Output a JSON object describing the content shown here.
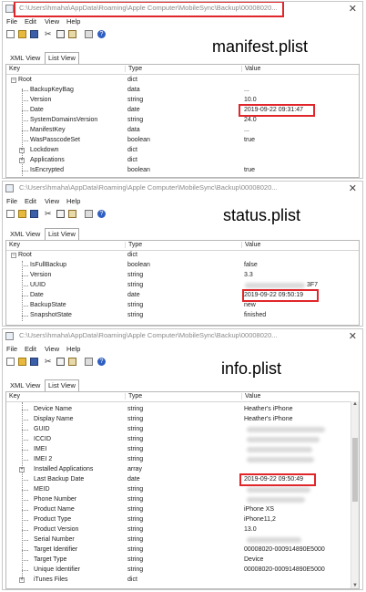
{
  "menu": [
    "File",
    "Edit",
    "View",
    "Help"
  ],
  "tabs": [
    "XML View",
    "List View"
  ],
  "columns": [
    "Key",
    "Type",
    "Value"
  ],
  "close_glyph": "✕",
  "panels": [
    {
      "title": "C:\\Users\\hmaha\\AppData\\Roaming\\Apple Computer\\MobileSync\\Backup\\00008020...",
      "caption": "manifest.plist",
      "rows": [
        {
          "key": "Root",
          "type": "dict",
          "value": ""
        },
        {
          "key": "BackupKeyBag",
          "type": "data",
          "value": "..."
        },
        {
          "key": "Version",
          "type": "string",
          "value": "10.0"
        },
        {
          "key": "Date",
          "type": "date",
          "value": "2019-09-22 09:31:47"
        },
        {
          "key": "SystemDomainsVersion",
          "type": "string",
          "value": "24.0"
        },
        {
          "key": "ManifestKey",
          "type": "data",
          "value": "..."
        },
        {
          "key": "WasPasscodeSet",
          "type": "boolean",
          "value": "true"
        },
        {
          "key": "Lockdown",
          "type": "dict",
          "value": ""
        },
        {
          "key": "Applications",
          "type": "dict",
          "value": ""
        },
        {
          "key": "IsEncrypted",
          "type": "boolean",
          "value": "true"
        }
      ]
    },
    {
      "title": "C:\\Users\\hmaha\\AppData\\Roaming\\Apple Computer\\MobileSync\\Backup\\00008020...",
      "caption": "status.plist",
      "rows": [
        {
          "key": "Root",
          "type": "dict",
          "value": ""
        },
        {
          "key": "IsFullBackup",
          "type": "boolean",
          "value": "false"
        },
        {
          "key": "Version",
          "type": "string",
          "value": "3.3"
        },
        {
          "key": "UUID",
          "type": "string",
          "value": "3F7"
        },
        {
          "key": "Date",
          "type": "date",
          "value": "2019-09-22 09:50:19"
        },
        {
          "key": "BackupState",
          "type": "string",
          "value": "new"
        },
        {
          "key": "SnapshotState",
          "type": "string",
          "value": "finished"
        }
      ]
    },
    {
      "title": "C:\\Users\\hmaha\\AppData\\Roaming\\Apple Computer\\MobileSync\\Backup\\00008020...",
      "caption": "info.plist",
      "rows": [
        {
          "key": "Device Name",
          "type": "string",
          "value": "Heather's iPhone"
        },
        {
          "key": "Display Name",
          "type": "string",
          "value": "Heather's iPhone"
        },
        {
          "key": "GUID",
          "type": "string",
          "value": ""
        },
        {
          "key": "ICCID",
          "type": "string",
          "value": ""
        },
        {
          "key": "IMEI",
          "type": "string",
          "value": ""
        },
        {
          "key": "IMEI 2",
          "type": "string",
          "value": ""
        },
        {
          "key": "Installed Applications",
          "type": "array",
          "value": ""
        },
        {
          "key": "Last Backup Date",
          "type": "date",
          "value": "2019-09-22 09:50:49"
        },
        {
          "key": "MEID",
          "type": "string",
          "value": ""
        },
        {
          "key": "Phone Number",
          "type": "string",
          "value": ""
        },
        {
          "key": "Product Name",
          "type": "string",
          "value": "iPhone XS"
        },
        {
          "key": "Product Type",
          "type": "string",
          "value": "iPhone11,2"
        },
        {
          "key": "Product Version",
          "type": "string",
          "value": "13.0"
        },
        {
          "key": "Serial Number",
          "type": "string",
          "value": ""
        },
        {
          "key": "Target Identifier",
          "type": "string",
          "value": "00008020-000914890E5000"
        },
        {
          "key": "Target Type",
          "type": "string",
          "value": "Device"
        },
        {
          "key": "Unique Identifier",
          "type": "string",
          "value": "00008020-000914890E5000"
        },
        {
          "key": "iTunes Files",
          "type": "dict",
          "value": ""
        }
      ]
    }
  ],
  "colors": {
    "highlight": "#e0262b",
    "border": "#b8b8b8"
  }
}
